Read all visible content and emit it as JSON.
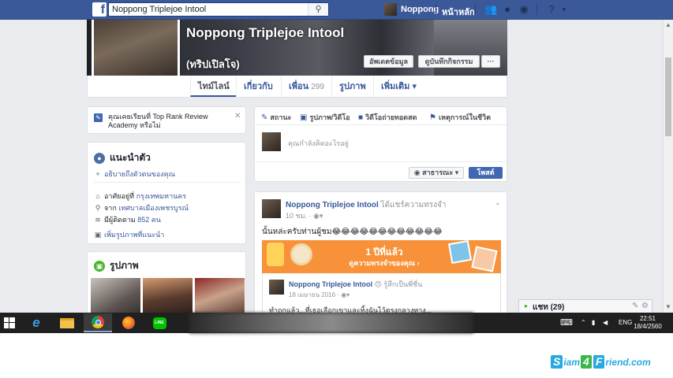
{
  "topbar": {
    "logo": "f",
    "search_value": "Noppong Triplejoe Intool",
    "search_icon": "search-icon",
    "user_name": "Noppong",
    "home_label": "หน้าหลัก"
  },
  "profile": {
    "name": "Noppong Triplejoe Intool",
    "alt_name": "(ทริปเปิลโจ)",
    "update_info_label": "อัพเดตข้อมูล",
    "activity_log_label": "ดูบันทึกกิจกรรม",
    "more_label": "···"
  },
  "tabs": [
    {
      "label": "ไทม์ไลน์"
    },
    {
      "label": "เกี่ยวกับ"
    },
    {
      "label": "เพื่อน",
      "count": "299"
    },
    {
      "label": "รูปภาพ"
    },
    {
      "label": "เพิ่มเติม ▾"
    }
  ],
  "prompt": {
    "text": "คุณเคยเรียนที่ Top Rank Review Academy หรือไม่"
  },
  "intro": {
    "title": "แนะนำตัว",
    "describe_link": "อธิบายถึงตัวตนของคุณ",
    "lives_prefix": "อาศัยอยู่ที่",
    "lives_value": "กรุงเทพมหานคร",
    "from_prefix": "จาก",
    "from_value": "เทศบาลเมืองเพชรบูรณ์",
    "followers_prefix": "มีผู้ติดตาม",
    "followers_value": "852 คน",
    "featured_link": "เพิ่มรูปภาพที่แนะนำ"
  },
  "photos": {
    "title": "รูปภาพ"
  },
  "composer": {
    "tabs": [
      {
        "label": "สถานะ"
      },
      {
        "label": "รูปภาพ/วิดีโอ"
      },
      {
        "label": "วิดีโอถ่ายทอดสด"
      },
      {
        "label": "เหตุการณ์ในชีวิต"
      }
    ],
    "placeholder": "คุณกำลังคิดอะไรอยู่",
    "privacy_label": "สาธารณะ ▾",
    "post_label": "โพสต์"
  },
  "post": {
    "author": "Noppong Triplejoe Intool",
    "action": "ได้แชร์ความทรงจำ",
    "time": "10 ชม. ·",
    "text": "นั้นหล่ะครับท่านผู้ชม😂😂😂😂😂😂😂😂😂😂😂😂",
    "memory_title": "1 ปีที่แล้ว",
    "memory_link": "ดูความทรงจำของคุณ ›",
    "shared_author": "Noppong Triplejoe Intool",
    "shared_feeling": "😠 รู้สึกเป็นพี่ชื่น",
    "shared_date": "18 เมษายน 2016 ·",
    "shared_text": "ทำถูกแล้ว...ที่เธอเลือกเขาและทิ้งฉันไว้ตรงกลางทาง..."
  },
  "chat": {
    "label": "แชท (29)"
  },
  "taskbar": {
    "lang": "ENG",
    "time": "22:51",
    "date": "18/4/2560"
  },
  "watermark": {
    "part1": "S",
    "part2": "iam",
    "part3": "4",
    "part4": "F",
    "part5": "riend.com"
  },
  "colors": {
    "fb_blue": "#3b5998",
    "link": "#365899",
    "memory_orange": "#f7923a"
  }
}
